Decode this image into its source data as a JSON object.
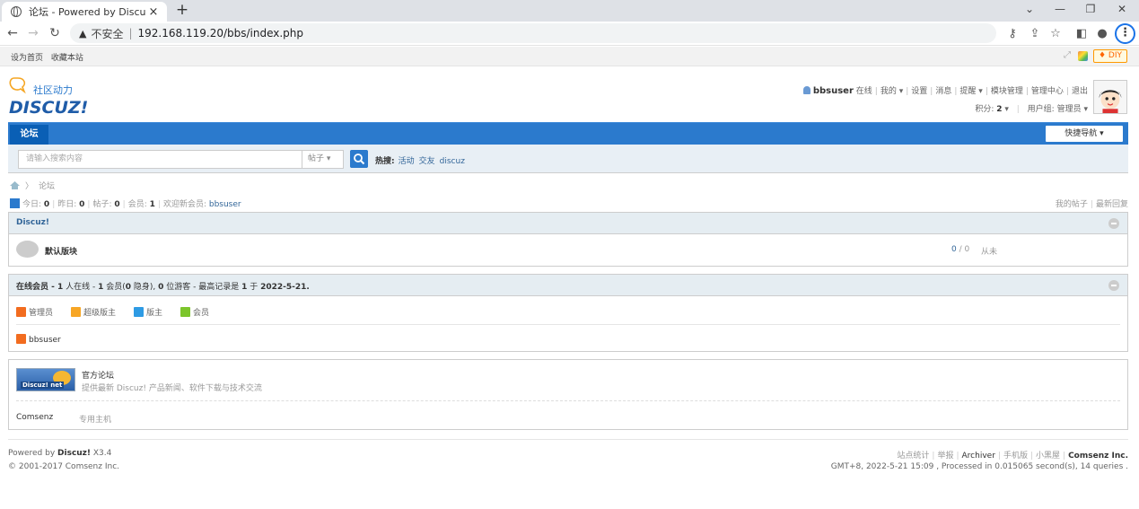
{
  "browser": {
    "tab_title": "论坛 - Powered by Discuz!",
    "tab_close": "×",
    "new_tab": "+",
    "insecure_label": "不安全",
    "separator": "|",
    "url": "192.168.119.20/bbs/index.php"
  },
  "topbar": {
    "set_home": "设为首页",
    "bookmark": "收藏本站",
    "diy": "♦ DIY"
  },
  "logo": {
    "tagline": "社区动力",
    "name": "DISCUZ!"
  },
  "userbar": {
    "username": "bbsuser",
    "status": "在线",
    "links": [
      "我的",
      "设置",
      "消息",
      "提醒",
      "模块管理",
      "管理中心",
      "退出"
    ],
    "credits_label": "积分:",
    "credits_value": "2",
    "group_label": "用户组:",
    "group_value": "管理员"
  },
  "nav": {
    "forum": "论坛",
    "quick_nav": "快捷导航 ▾"
  },
  "search": {
    "placeholder": "请输入搜索内容",
    "type": "帖子",
    "hot_label": "热搜:",
    "hot_links": [
      "活动",
      "交友",
      "discuz"
    ]
  },
  "breadcrumb": {
    "current": "论坛"
  },
  "stats": {
    "today_label": "今日:",
    "today": "0",
    "yesterday_label": "昨日:",
    "yesterday": "0",
    "posts_label": "帖子:",
    "posts": "0",
    "members_label": "会员:",
    "members": "1",
    "welcome_label": "欢迎新会员:",
    "newest_member": "bbsuser",
    "my_posts": "我的帖子",
    "latest_replies": "最新回复"
  },
  "category": {
    "title": "Discuz!",
    "forums": [
      {
        "name": "默认版块",
        "threads": "0",
        "slash": "/",
        "posts": "0",
        "last_post": "从未"
      }
    ]
  },
  "online": {
    "title_prefix": "在线会员 - ",
    "total": "1",
    "total_label": " 人在线 - ",
    "members": "1",
    "members_label": " 会员(",
    "hidden": "0",
    "hidden_label": " 隐身), ",
    "guests": "0",
    "guests_label": " 位游客 - 最高记录是 ",
    "record": "1",
    "record_label": " 于 ",
    "record_date": "2022-5-21.",
    "legend": [
      {
        "label": "管理员",
        "color": "#f26c1f"
      },
      {
        "label": "超级版主",
        "color": "#f7a625"
      },
      {
        "label": "版主",
        "color": "#2e9be4"
      },
      {
        "label": "会员",
        "color": "#7cc52b"
      }
    ],
    "users": [
      "bbsuser"
    ]
  },
  "links": {
    "banner_text": "Discuz! net",
    "title": "官方论坛",
    "desc": "提供最新 Discuz! 产品新闻、软件下载与技术交流",
    "text1": "Comsenz",
    "text2": "专用主机"
  },
  "footer": {
    "powered_label": "Powered by ",
    "powered_name": "Discuz!",
    "version": " X3.4",
    "copyright": "© 2001-2017 Comsenz Inc.",
    "links": [
      "站点统计",
      "举报",
      "Archiver",
      "手机版",
      "小黑屋"
    ],
    "company": "Comsenz Inc.",
    "debug": "GMT+8, 2022-5-21 15:09 , Processed in 0.015065 second(s), 14 queries ."
  },
  "colors": {
    "brand_blue": "#2b7acd",
    "nav_active": "#0a5fb5",
    "header_bg": "#e5edf2",
    "link": "#336699"
  }
}
